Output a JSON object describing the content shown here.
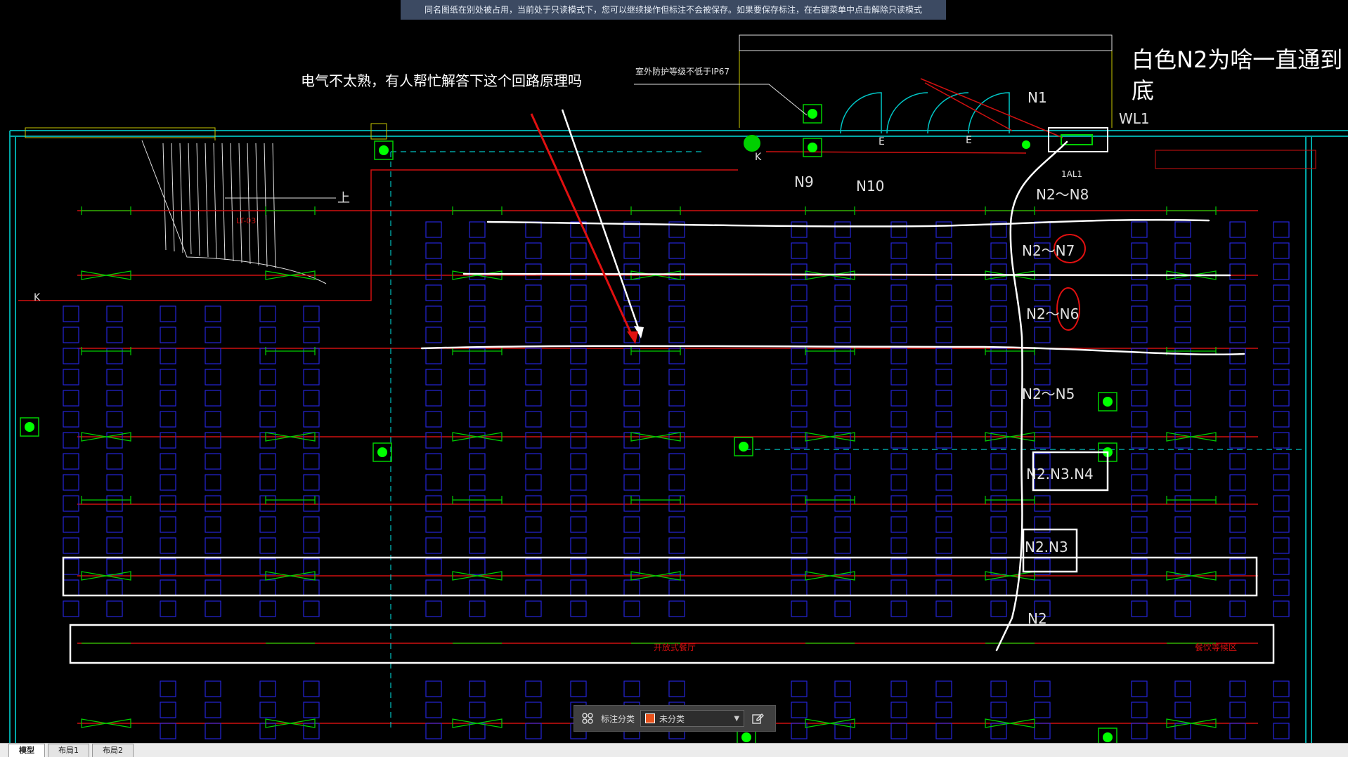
{
  "banner": {
    "text": "同名图纸在别处被占用，当前处于只读模式下，您可以继续操作但标注不会被保存。如果要保存标注，在右键菜单中点击解除只读模式"
  },
  "annotations": {
    "question": "电气不太熟，有人帮忙解答下这个回路原理吗",
    "title_line1": "白色N2为啥一直通到",
    "title_line2": "底",
    "ip_note": "室外防护等级不低于IP67"
  },
  "labels": {
    "n1": "N1",
    "wl1": "WL1",
    "al1": "1AL1",
    "n9": "N9",
    "n10": "N10",
    "n2n8": "N2～N8",
    "n2n7": "N2～N7",
    "n2n6": "N2～N6",
    "n2n5": "N2～N5",
    "n2n3n4": "N2.N3.N4",
    "n2n3": "N2.N3",
    "n2": "N2",
    "up": "上",
    "lt": "LT-03",
    "e1": "E",
    "e2": "E",
    "k1": "K",
    "k2": "K",
    "room1": "开放式餐厅",
    "room2": "餐饮等候区"
  },
  "toolbar": {
    "category_label": "标注分类",
    "selected": "未分类",
    "swatch_color": "#e8521c",
    "icons": [
      "grid-icon",
      "edit-icon"
    ]
  },
  "tabs": [
    {
      "label": "模型",
      "active": true
    },
    {
      "label": "布局1",
      "active": false
    },
    {
      "label": "布局2",
      "active": false
    }
  ],
  "colors": {
    "background": "#000000",
    "wall": "#00a0a0",
    "circuit": "#d01010",
    "fixture": "#2020d0",
    "device": "#00d000",
    "markup": "#ffffff"
  }
}
